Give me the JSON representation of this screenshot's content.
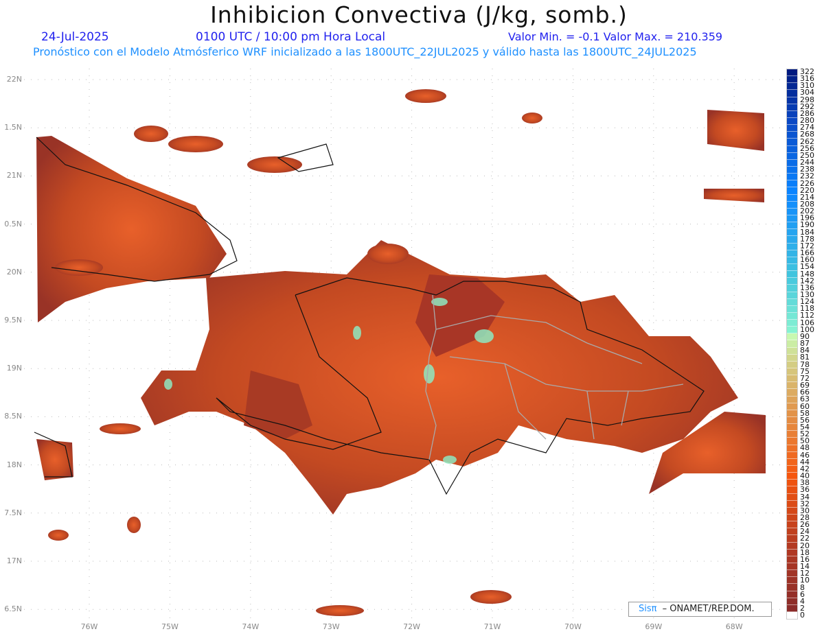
{
  "header": {
    "title": "Inhibicion Convectiva (J/kg, somb.)",
    "date": "24-Jul-2025",
    "time": "0100 UTC / 10:00 pm Hora Local",
    "minmax": "Valor Min. = -0.1  Valor Max. = 210.359",
    "model_line": "Pronóstico con el Modelo Atmósferico WRF inicializado a las 1800UTC_22JUL2025 y válido hasta las  1800UTC_24JUL2025"
  },
  "axes": {
    "lat_labels": [
      "22N",
      "1.5N",
      "21N",
      "0.5N",
      "20N",
      "9.5N",
      "19N",
      "8.5N",
      "18N",
      "7.5N",
      "17N",
      "6.5N"
    ],
    "lon_labels": [
      "76W",
      "75W",
      "74W",
      "73W",
      "72W",
      "71W",
      "70W",
      "69W",
      "68W"
    ]
  },
  "colorbar": {
    "labels": [
      "322",
      "316",
      "310",
      "304",
      "298",
      "292",
      "286",
      "280",
      "274",
      "268",
      "262",
      "256",
      "250",
      "244",
      "238",
      "232",
      "226",
      "220",
      "214",
      "208",
      "202",
      "196",
      "190",
      "184",
      "178",
      "172",
      "166",
      "160",
      "154",
      "148",
      "142",
      "136",
      "130",
      "124",
      "118",
      "112",
      "106",
      "100",
      "90",
      "87",
      "84",
      "81",
      "78",
      "75",
      "72",
      "69",
      "66",
      "63",
      "60",
      "58",
      "56",
      "54",
      "52",
      "50",
      "48",
      "46",
      "44",
      "42",
      "40",
      "38",
      "36",
      "34",
      "32",
      "30",
      "28",
      "26",
      "24",
      "22",
      "20",
      "18",
      "16",
      "14",
      "12",
      "10",
      "8",
      "6",
      "4",
      "2",
      "0"
    ],
    "anchors": [
      [
        0,
        "#ffffff"
      ],
      [
        2,
        "#8b2c2a"
      ],
      [
        20,
        "#b33a22"
      ],
      [
        40,
        "#f5560e"
      ],
      [
        60,
        "#e09a50"
      ],
      [
        81,
        "#d2d68c"
      ],
      [
        90,
        "#c8f8b0"
      ],
      [
        100,
        "#86f2d2"
      ],
      [
        148,
        "#40c4de"
      ],
      [
        220,
        "#0a84ff"
      ],
      [
        280,
        "#0a48c4"
      ],
      [
        322,
        "#001a80"
      ]
    ]
  },
  "logo": {
    "brand": "Sisπ",
    "org": "– ONAMET/REP.DOM."
  }
}
